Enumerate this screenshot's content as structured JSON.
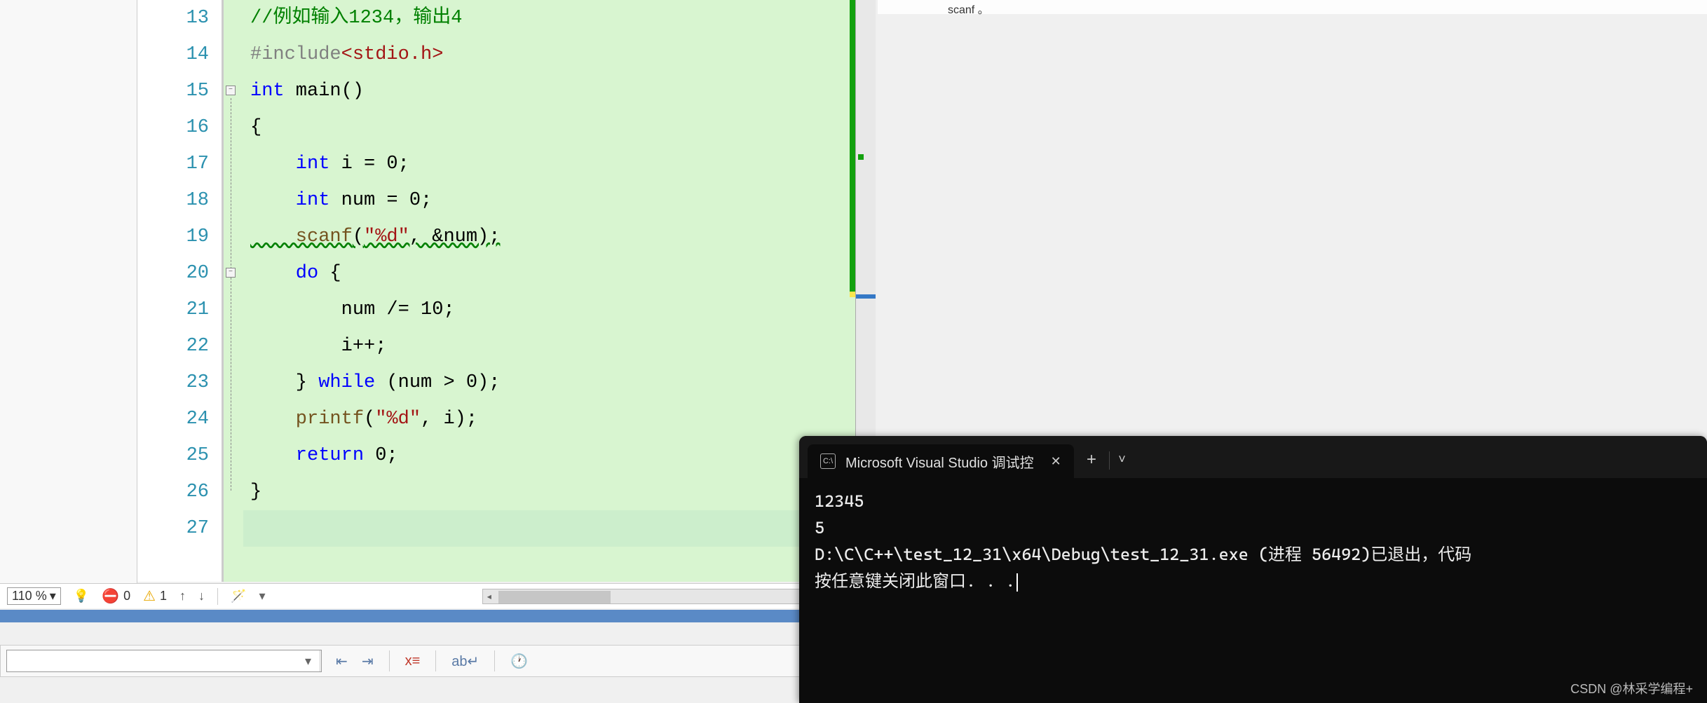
{
  "editor": {
    "line_numbers": [
      "13",
      "14",
      "15",
      "16",
      "17",
      "18",
      "19",
      "20",
      "21",
      "22",
      "23",
      "24",
      "25",
      "26",
      "27"
    ],
    "code": {
      "l13_comment": "//例如输入1234，输出4",
      "l14_include": "#include",
      "l14_header": "<stdio.h>",
      "l15_type": "int",
      "l15_main": " main()",
      "l16": "{",
      "l17_type": "    int",
      "l17_rest": " i = 0;",
      "l18_type": "    int",
      "l18_rest": " num = 0;",
      "l19_func": "    scanf",
      "l19_paren_open": "(",
      "l19_str": "\"%d\"",
      "l19_rest": ", &num);",
      "l20_do": "    do",
      "l20_brace": " {",
      "l21": "        num /= 10;",
      "l22": "        i++;",
      "l23_close": "    } ",
      "l23_while": "while",
      "l23_cond": " (num > 0);",
      "l24_func": "    printf",
      "l24_paren": "(",
      "l24_str": "\"%d\"",
      "l24_rest": ", i);",
      "l25_ret": "    return",
      "l25_val": " 0;",
      "l26": "}"
    }
  },
  "status": {
    "zoom": "110 %",
    "errors": "0",
    "warnings": "1"
  },
  "right_panel": {
    "text": "scanf 。"
  },
  "console": {
    "tab_title": "Microsoft Visual Studio 调试控",
    "line1": "12345",
    "line2": "5",
    "line3": "D:\\C\\C++\\test_12_31\\x64\\Debug\\test_12_31.exe (进程 56492)已退出，代码",
    "line4": "按任意键关闭此窗口. . ."
  },
  "watermark": "CSDN @林采学编程+"
}
